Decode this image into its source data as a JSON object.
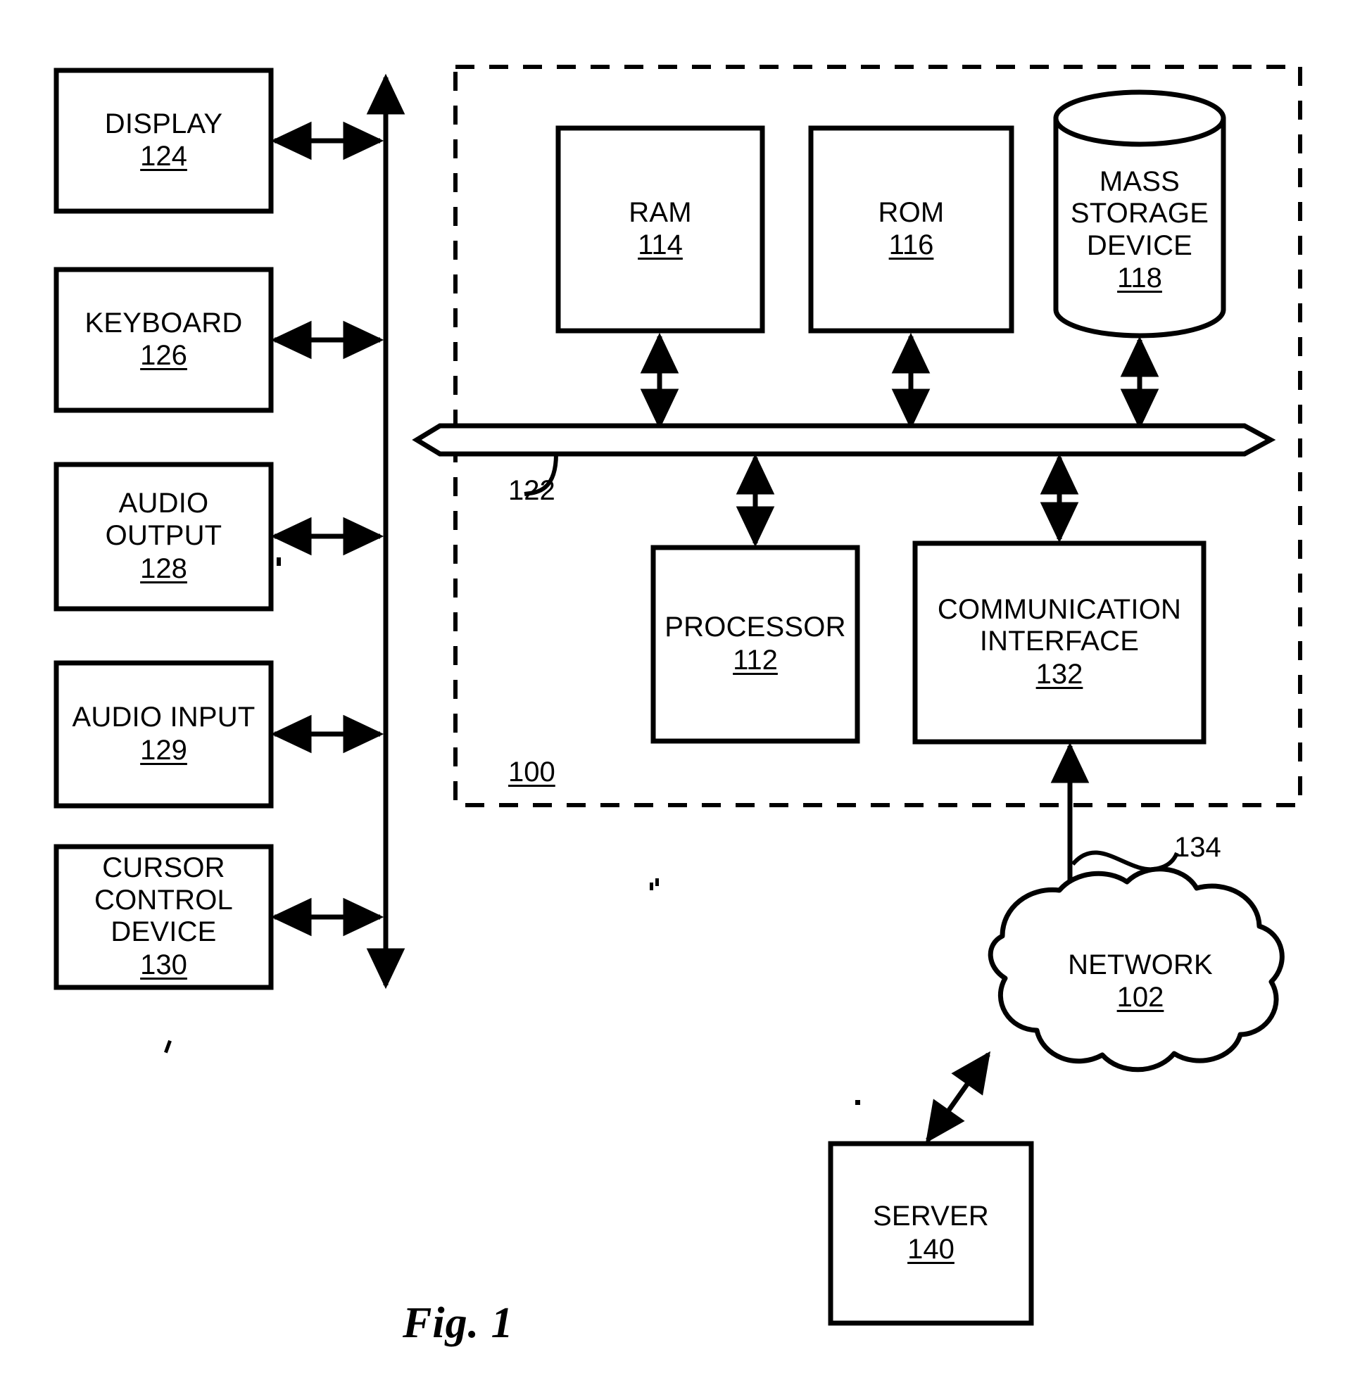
{
  "figure": {
    "caption": "Fig. 1",
    "system_ref": "100",
    "bus_ref": "122",
    "network_link_ref": "134"
  },
  "peripherals": [
    {
      "name": "display",
      "lines": [
        "DISPLAY"
      ],
      "ref": "124"
    },
    {
      "name": "keyboard",
      "lines": [
        "KEYBOARD"
      ],
      "ref": "126"
    },
    {
      "name": "audio-output",
      "lines": [
        "AUDIO",
        "OUTPUT"
      ],
      "ref": "128"
    },
    {
      "name": "audio-input",
      "lines": [
        "AUDIO INPUT"
      ],
      "ref": "129"
    },
    {
      "name": "cursor-control-device",
      "lines": [
        "CURSOR",
        "CONTROL",
        "DEVICE"
      ],
      "ref": "130"
    }
  ],
  "system_components": [
    {
      "name": "ram",
      "lines": [
        "RAM"
      ],
      "ref": "114"
    },
    {
      "name": "rom",
      "lines": [
        "ROM"
      ],
      "ref": "116"
    },
    {
      "name": "mass-storage-device",
      "lines": [
        "MASS",
        "STORAGE",
        "DEVICE"
      ],
      "ref": "118"
    },
    {
      "name": "processor",
      "lines": [
        "PROCESSOR"
      ],
      "ref": "112"
    },
    {
      "name": "communication-interface",
      "lines": [
        "COMMUNICATION",
        "INTERFACE"
      ],
      "ref": "132"
    }
  ],
  "external_nodes": [
    {
      "name": "network",
      "lines": [
        "NETWORK"
      ],
      "ref": "102"
    },
    {
      "name": "server",
      "lines": [
        "SERVER"
      ],
      "ref": "140"
    }
  ],
  "colors": {
    "line": "#000000",
    "background": "#ffffff"
  }
}
